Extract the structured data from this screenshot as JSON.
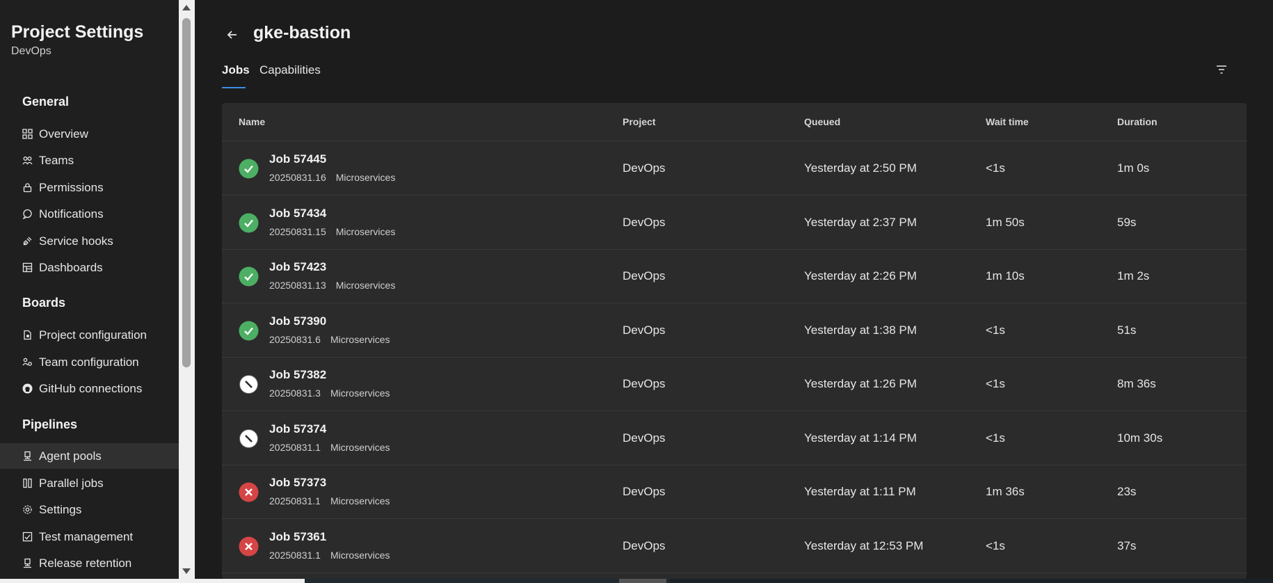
{
  "sidebar": {
    "title": "Project Settings",
    "subtitle": "DevOps",
    "sections": {
      "general": "General",
      "boards": "Boards",
      "pipelines": "Pipelines"
    },
    "items": {
      "overview": "Overview",
      "teams": "Teams",
      "permissions": "Permissions",
      "notifications": "Notifications",
      "service_hooks": "Service hooks",
      "dashboards": "Dashboards",
      "project_configuration": "Project configuration",
      "team_configuration": "Team configuration",
      "github_connections": "GitHub connections",
      "agent_pools": "Agent pools",
      "parallel_jobs": "Parallel jobs",
      "settings": "Settings",
      "test_management": "Test management",
      "release_retention": "Release retention"
    },
    "active_item": "agent_pools"
  },
  "header": {
    "title": "gke-bastion",
    "tabs": {
      "jobs": "Jobs",
      "capabilities": "Capabilities"
    },
    "active_tab": "jobs"
  },
  "table": {
    "columns": {
      "name": "Name",
      "project": "Project",
      "queued": "Queued",
      "wait_time": "Wait time",
      "duration": "Duration"
    },
    "rows": [
      {
        "status": "succeeded",
        "name": "Job 57445",
        "build": "20250831.16",
        "pipeline": "Microservices",
        "project": "DevOps",
        "queued": "Yesterday at 2:50 PM",
        "wait_time": "<1s",
        "duration": "1m 0s"
      },
      {
        "status": "succeeded",
        "name": "Job 57434",
        "build": "20250831.15",
        "pipeline": "Microservices",
        "project": "DevOps",
        "queued": "Yesterday at 2:37 PM",
        "wait_time": "1m 50s",
        "duration": "59s"
      },
      {
        "status": "succeeded",
        "name": "Job 57423",
        "build": "20250831.13",
        "pipeline": "Microservices",
        "project": "DevOps",
        "queued": "Yesterday at 2:26 PM",
        "wait_time": "1m 10s",
        "duration": "1m 2s"
      },
      {
        "status": "succeeded",
        "name": "Job 57390",
        "build": "20250831.6",
        "pipeline": "Microservices",
        "project": "DevOps",
        "queued": "Yesterday at 1:38 PM",
        "wait_time": "<1s",
        "duration": "51s"
      },
      {
        "status": "canceled",
        "name": "Job 57382",
        "build": "20250831.3",
        "pipeline": "Microservices",
        "project": "DevOps",
        "queued": "Yesterday at 1:26 PM",
        "wait_time": "<1s",
        "duration": "8m 36s"
      },
      {
        "status": "canceled",
        "name": "Job 57374",
        "build": "20250831.1",
        "pipeline": "Microservices",
        "project": "DevOps",
        "queued": "Yesterday at 1:14 PM",
        "wait_time": "<1s",
        "duration": "10m 30s"
      },
      {
        "status": "failed",
        "name": "Job 57373",
        "build": "20250831.1",
        "pipeline": "Microservices",
        "project": "DevOps",
        "queued": "Yesterday at 1:11 PM",
        "wait_time": "1m 36s",
        "duration": "23s"
      },
      {
        "status": "failed",
        "name": "Job 57361",
        "build": "20250831.1",
        "pipeline": "Microservices",
        "project": "DevOps",
        "queued": "Yesterday at 12:53 PM",
        "wait_time": "<1s",
        "duration": "37s"
      }
    ]
  },
  "colors": {
    "succeeded": "#4caf63",
    "failed": "#d64545",
    "canceled": "#ffffff",
    "accent": "#3a8ee6"
  },
  "icons": {
    "back": "arrow-left-icon",
    "filter": "filter-icon",
    "succeeded": "check-circle-icon",
    "failed": "x-circle-icon",
    "canceled": "canceled-circle-icon"
  }
}
